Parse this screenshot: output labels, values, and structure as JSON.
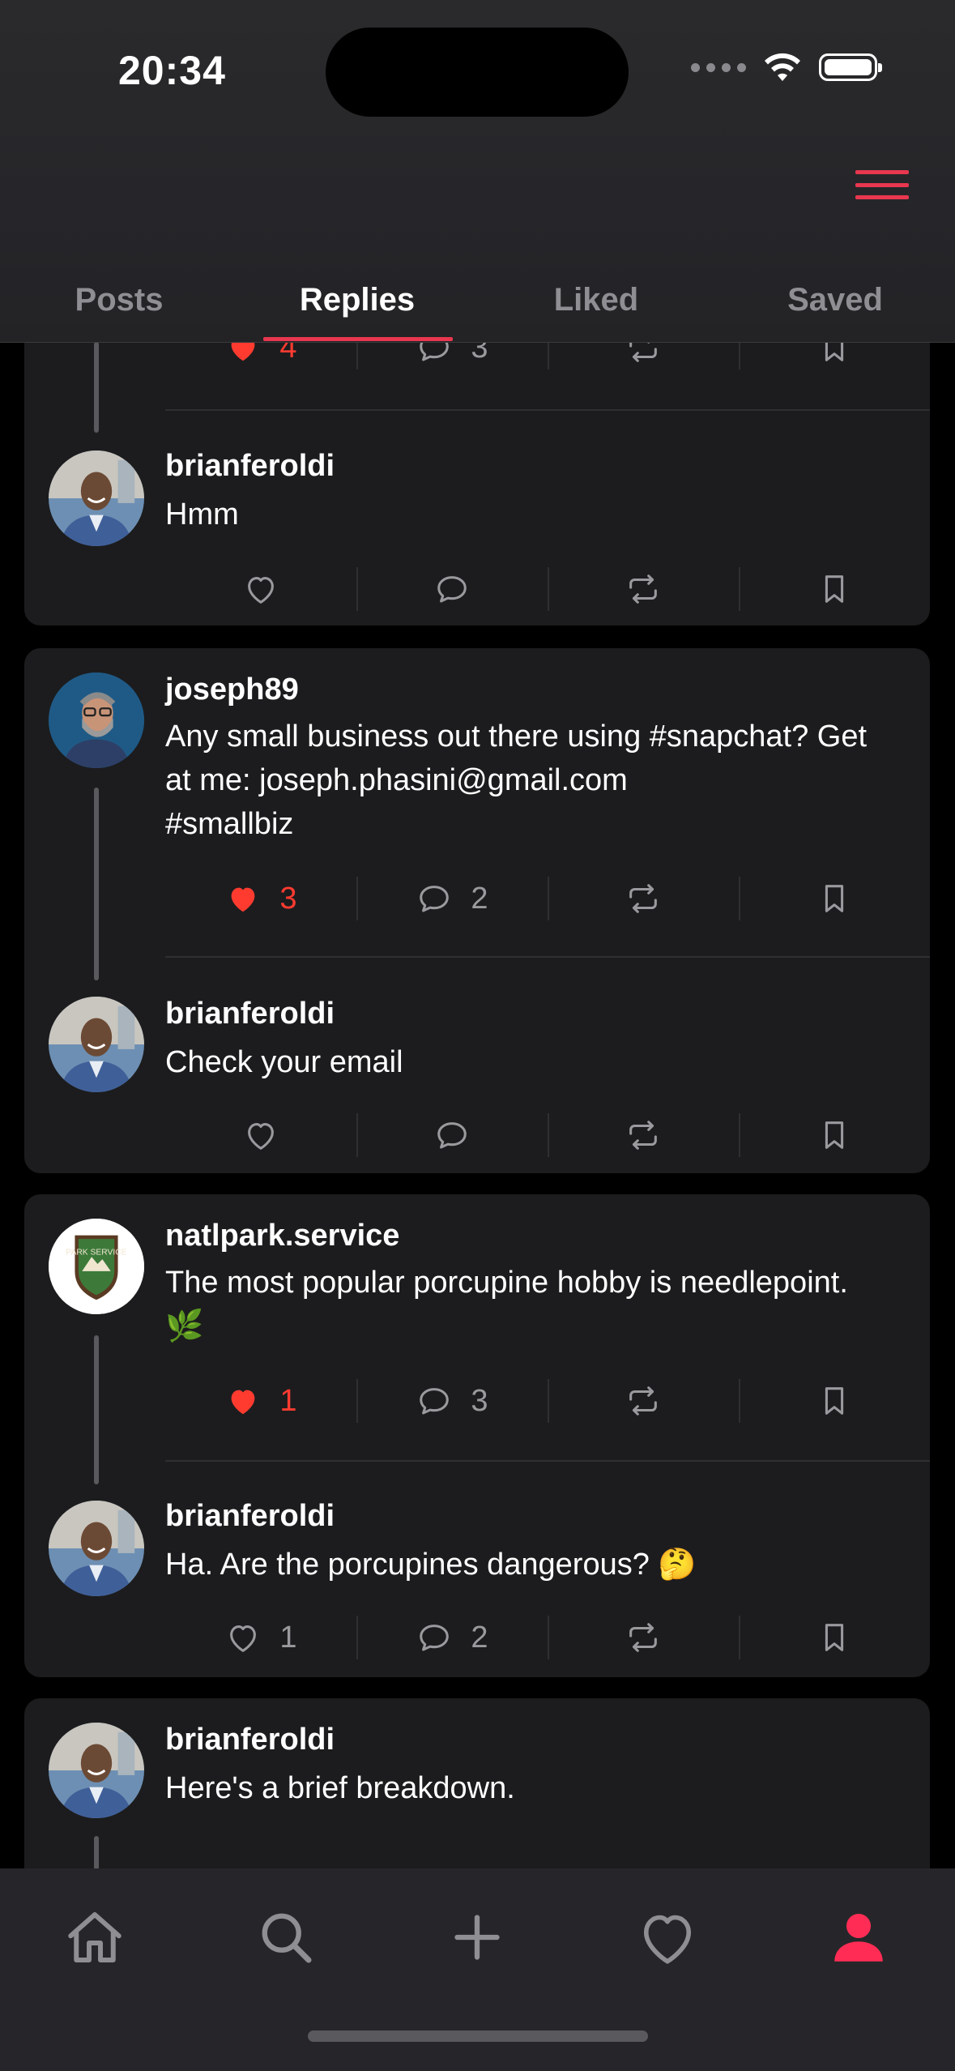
{
  "status_bar": {
    "time": "20:34"
  },
  "tabs": [
    {
      "label": "Posts"
    },
    {
      "label": "Replies"
    },
    {
      "label": "Liked"
    },
    {
      "label": "Saved"
    }
  ],
  "active_tab": "Replies",
  "accent_color": "#e8374f",
  "like_color": "#ff3b30",
  "feed": {
    "top_partial": {
      "likes": "4",
      "comments": "3"
    },
    "thread1_reply": {
      "username": "brianferoldi",
      "text": "Hmm"
    },
    "thread2": {
      "post": {
        "username": "joseph89",
        "text_line1": "Any small business out there using #snapchat? Get",
        "text_line2": "at me: joseph.phasini@gmail.com",
        "text_line3": "#smallbiz",
        "likes": "3",
        "comments": "2"
      },
      "reply": {
        "username": "brianferoldi",
        "text": "Check your email"
      }
    },
    "thread3": {
      "post": {
        "username": "natlpark.service",
        "text_line1": "The most popular porcupine hobby is needlepoint.",
        "emoji": "🌿",
        "likes": "1",
        "comments": "3",
        "avatar_text": "PARK SERVICE"
      },
      "reply": {
        "username": "brianferoldi",
        "text": "Ha. Are the porcupines dangerous? 🤔",
        "likes": "1",
        "comments": "2"
      }
    },
    "thread4": {
      "post": {
        "username": "brianferoldi",
        "text": "Here's a brief breakdown."
      }
    }
  },
  "bottom_nav": [
    {
      "icon": "home-icon"
    },
    {
      "icon": "search-icon"
    },
    {
      "icon": "plus-icon"
    },
    {
      "icon": "heart-icon"
    },
    {
      "icon": "profile-icon"
    }
  ]
}
